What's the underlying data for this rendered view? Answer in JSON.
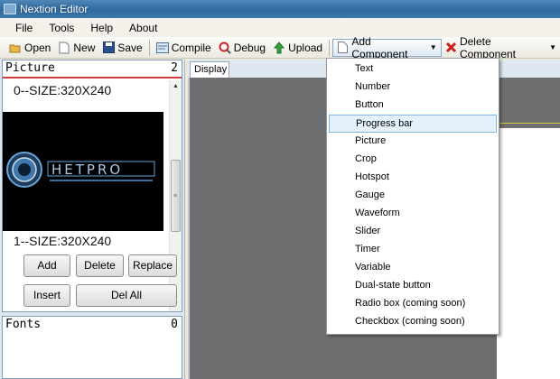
{
  "window": {
    "title": "Nextion Editor"
  },
  "menu": [
    "File",
    "Tools",
    "Help",
    "About"
  ],
  "toolbar": {
    "open": "Open",
    "new": "New",
    "save": "Save",
    "compile": "Compile",
    "debug": "Debug",
    "upload": "Upload",
    "add_component": "Add Component",
    "delete_component": "Delete Component"
  },
  "picture_panel": {
    "title": "Picture",
    "count": "2",
    "items": [
      "0--SIZE:320X240",
      "1--SIZE:320X240"
    ],
    "logo_text": "HETPRO"
  },
  "picture_buttons": {
    "add": "Add",
    "delete": "Delete",
    "replace": "Replace",
    "insert": "Insert",
    "del_all": "Del All"
  },
  "fonts_panel": {
    "title": "Fonts",
    "count": "0"
  },
  "display": {
    "tab": "Display"
  },
  "component_menu": {
    "items": [
      "Text",
      "Number",
      "Button",
      "Progress bar",
      "Picture",
      "Crop",
      "Hotspot",
      "Gauge",
      "Waveform",
      "Slider",
      "Timer",
      "Variable",
      "Dual-state button",
      "Radio box (coming soon)",
      "Checkbox (coming soon)"
    ],
    "highlighted": "Progress bar"
  }
}
